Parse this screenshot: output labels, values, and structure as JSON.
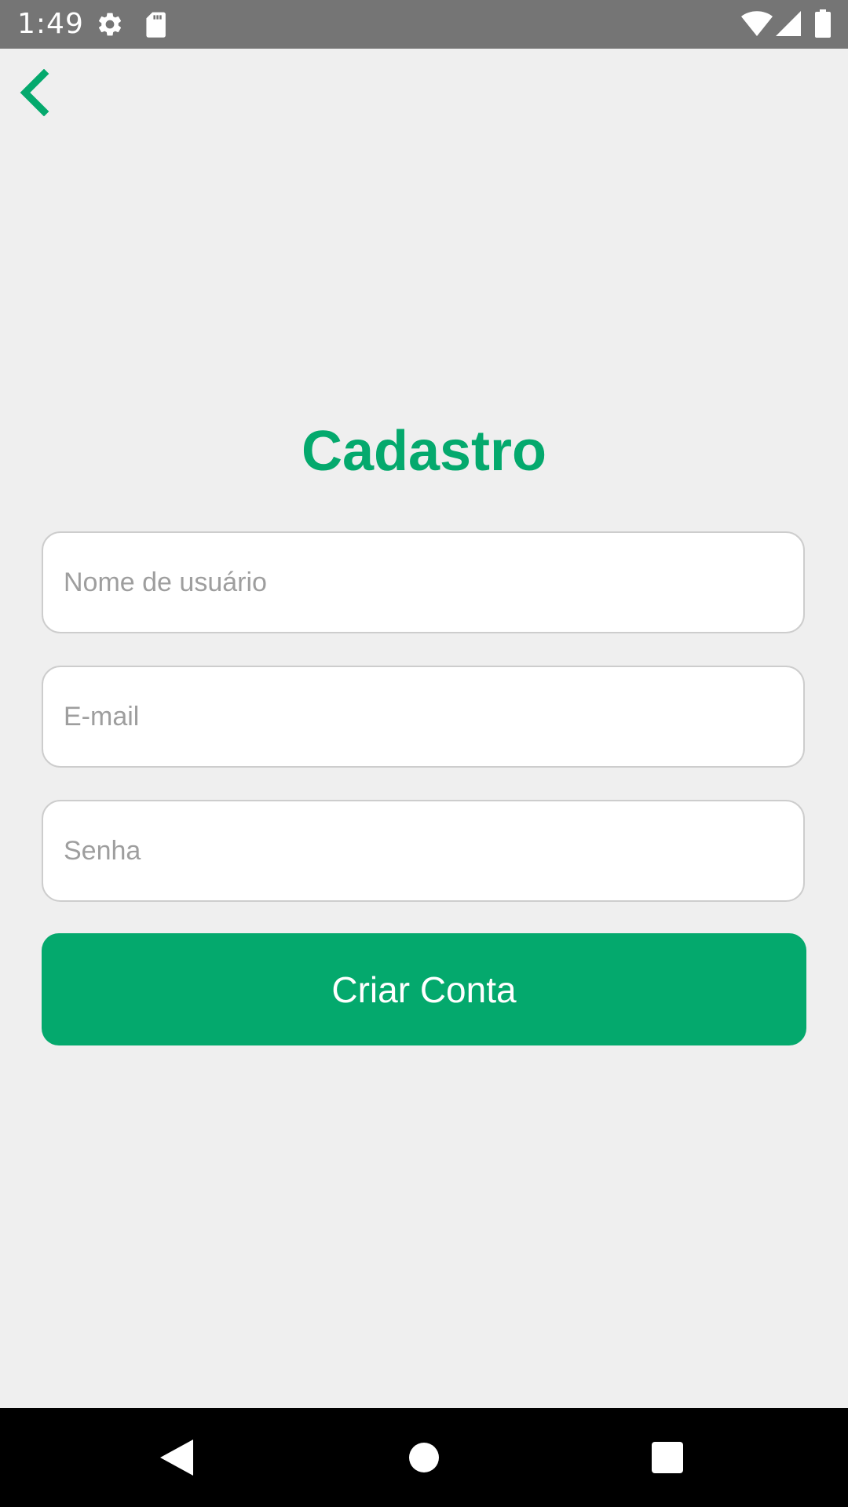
{
  "status_bar": {
    "time": "1:49",
    "icons": [
      "gear-icon",
      "sd-card-icon",
      "wifi-icon",
      "signal-icon",
      "battery-icon"
    ]
  },
  "header": {
    "back_icon": "chevron-left-icon"
  },
  "form": {
    "title": "Cadastro",
    "username_placeholder": "Nome de usuário",
    "email_placeholder": "E-mail",
    "password_placeholder": "Senha",
    "submit_label": "Criar Conta"
  },
  "nav_bar": {
    "icons": [
      "back-triangle-icon",
      "home-circle-icon",
      "recents-square-icon"
    ]
  },
  "colors": {
    "accent": "#04a96d",
    "background": "#efefef",
    "status_bar": "#757575",
    "nav_bar": "#000000"
  }
}
